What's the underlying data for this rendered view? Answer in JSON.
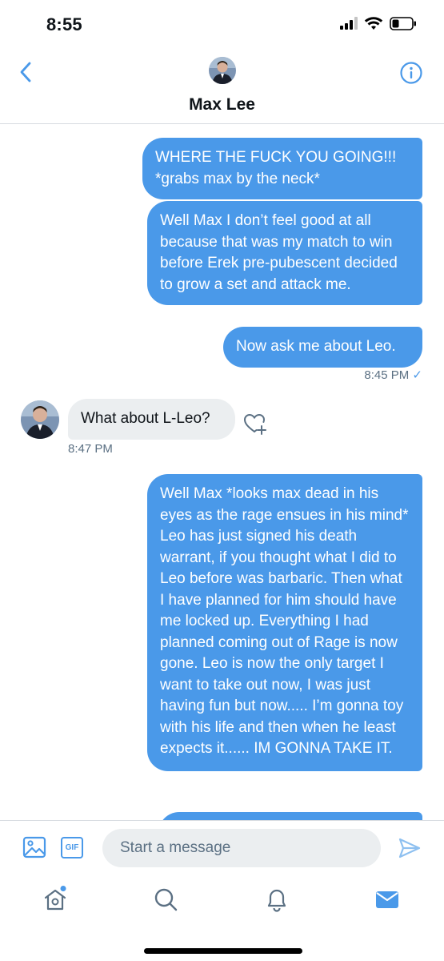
{
  "status_bar": {
    "time": "8:55"
  },
  "header": {
    "title": "Max Lee"
  },
  "messages": [
    {
      "direction": "outgoing",
      "text": "WHERE THE FUCK YOU GOING!!! *grabs max by the neck*"
    },
    {
      "direction": "outgoing",
      "text": "Well Max I don’t feel good at all because that was my match to win before Erek pre-pubescent decided to grow a set and attack me."
    },
    {
      "direction": "outgoing",
      "text": "Now ask me about Leo."
    },
    {
      "direction": "incoming",
      "text": "What about L-Leo?"
    },
    {
      "direction": "outgoing",
      "text": "Well Max *looks max dead in his eyes as the rage ensues in his mind* Leo has just signed his death warrant, if you thought what I did to Leo before was barbaric. Then what I have planned for him should have me locked up. Everything I had planned coming out of Rage is now gone. Leo is now the only target I want to take out now, I was just having fun but now..... I’m gonna toy with his life and then when he least expects it...... IM GONNA TAKE IT."
    },
    {
      "direction": "outgoing",
      "text": ""
    }
  ],
  "timestamps": {
    "outgoing_group": "8:45 PM",
    "read_mark": "✓",
    "incoming": "8:47 PM"
  },
  "composer": {
    "placeholder": "Start a message",
    "gif_label": "GIF"
  },
  "icons": {
    "back": "chevron-left-icon",
    "info": "info-icon",
    "react": "heart-plus-icon",
    "image": "image-icon",
    "send": "send-icon",
    "tabs": [
      "home-icon",
      "search-icon",
      "notifications-icon",
      "messages-icon"
    ]
  },
  "colors": {
    "accent": "#4a99e9",
    "incoming_bubble": "#ebeef0",
    "meta_text": "#5b7083"
  }
}
